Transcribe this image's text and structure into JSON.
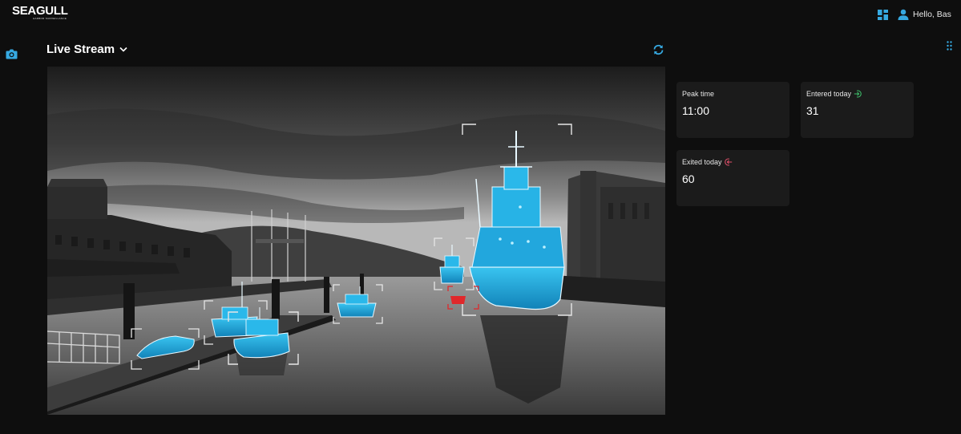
{
  "brand": {
    "logo_text": "SEAGULL",
    "logo_subtext": "HARBOR SURVEILLANCE"
  },
  "header": {
    "greeting": "Hello, Bas"
  },
  "stream": {
    "title": "Live Stream"
  },
  "stats": [
    {
      "label": "Peak time",
      "value": "11:00"
    },
    {
      "label": "Entered today",
      "value": "31",
      "indicator": "enter-icon",
      "color": "#3ec06b"
    },
    {
      "label": "Exited today",
      "value": "60",
      "indicator": "exit-icon",
      "color": "#e0506a"
    }
  ],
  "colors": {
    "accent": "#36a9e1",
    "detection": "#1ea7d8",
    "alert": "#e0282b",
    "background": "#0e0e0e",
    "card": "#1b1b1b"
  },
  "icons": [
    "dashboard-icon",
    "user-icon",
    "camera-icon",
    "refresh-icon",
    "drag-handle-icon",
    "chevron-down-icon"
  ]
}
